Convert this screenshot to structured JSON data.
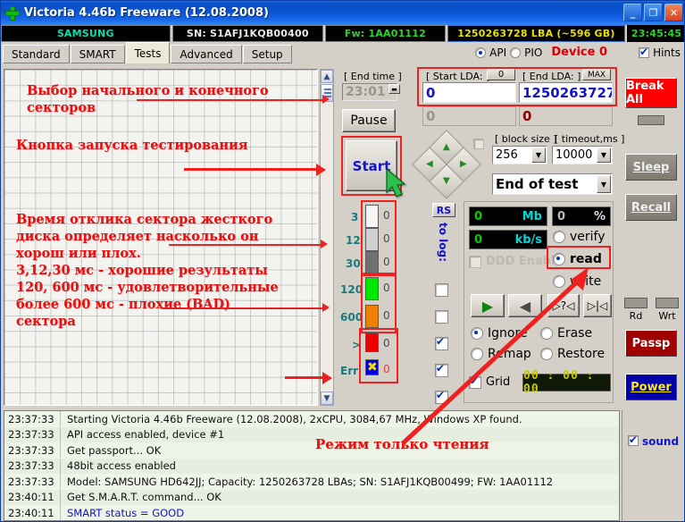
{
  "window": {
    "title": "Victoria 4.46b Freeware (12.08.2008)",
    "icon": "green-cross-icon",
    "minimize": "_",
    "maximize": "❐",
    "close": "✕"
  },
  "device_info": {
    "model": "SAMSUNG",
    "serial": "SN: S1AFJ1KQB00400",
    "firmware": "Fw: 1AA01112",
    "capacity": "1250263728 LBA (~596 GB)",
    "clock": "23:45:45"
  },
  "tabs": [
    {
      "label": "Standard",
      "active": false
    },
    {
      "label": "SMART",
      "active": false
    },
    {
      "label": "Tests",
      "active": true
    },
    {
      "label": "Advanced",
      "active": false
    },
    {
      "label": "Setup",
      "active": false
    }
  ],
  "access_mode": {
    "api_label": "API",
    "api_selected": true,
    "pio_label": "PIO",
    "pio_selected": false,
    "device_label": "Device 0"
  },
  "hints": {
    "label": "Hints",
    "checked": true
  },
  "annotations": {
    "sector_range": "Выбор начального и конечного\nсекторов",
    "start_button": "Кнопка запуска тестирования",
    "timings": "Время отклика сектора жесткого\nдиска определяет насколько он\nхорош или плох.\n3,12,30 мс - хорошие результаты\n120, 600 мс - удовлетворительные\nболее 600 мс - плохие (BAD)\nсектора",
    "read_only": "Режим только чтения"
  },
  "panel": {
    "end_time_label": "[ End time ]",
    "end_time_value": "23:01",
    "start_lba_label": "[ Start LDA: ]",
    "start_lba_zero": "0",
    "start_lba_value": "0",
    "end_lba_label": "[ End LDA: ]",
    "end_lba_max": "MAX",
    "end_lba_value": "1250263727",
    "cur_start_value": "0",
    "cur_end_value": "0",
    "pause_label": "Pause",
    "start_label": "Start",
    "block_size_label": "[ block size ]",
    "block_size_value": "256",
    "timeout_label": "[ timeout,ms ]",
    "timeout_value": "10000",
    "end_of_test_value": "End of test",
    "rs_label": "RS",
    "to_log_label": "to log:",
    "to_log_checks": [
      false,
      false,
      true,
      true,
      true
    ],
    "mb_value": "0",
    "mb_unit": "Mb",
    "pct_value": "0",
    "pct_unit": "%",
    "kbs_value": "0",
    "kbs_unit": "kb/s",
    "ddd_enable_label": "DDD Enable",
    "ddd_enable_checked": false,
    "ops": [
      {
        "label": "verify",
        "selected": false
      },
      {
        "label": "read",
        "selected": true
      },
      {
        "label": "write",
        "selected": false
      }
    ],
    "transport": [
      "▶",
      "◀",
      "?",
      "▶|◀"
    ],
    "bad_actions": [
      {
        "label": "Ignore",
        "selected": true
      },
      {
        "label": "Erase",
        "selected": false
      },
      {
        "label": "Remap",
        "selected": false
      },
      {
        "label": "Restore",
        "selected": false
      }
    ],
    "grid_label": "Grid",
    "grid_checked": true,
    "timer_value": "00 : 00 : 00"
  },
  "timings": [
    {
      "label": "3",
      "color": "#f5f5f5",
      "count": "0"
    },
    {
      "label": "12",
      "color": "#d0d0d0",
      "count": "0"
    },
    {
      "label": "30",
      "color": "#707070",
      "count": "0"
    },
    {
      "label": "120",
      "color": "#00e800",
      "count": "0"
    },
    {
      "label": "600",
      "color": "#f08000",
      "count": "0"
    },
    {
      "label": ">",
      "color": "#ee0000",
      "count": "0"
    },
    {
      "label": "Err",
      "color": "#0000dd",
      "count": "0"
    }
  ],
  "right_buttons": {
    "break_all": "Break All",
    "sleep": "Sleep",
    "recall": "Recall",
    "rd_label": "Rd",
    "wrt_label": "Wrt",
    "passp": "Passp",
    "power": "Power"
  },
  "log": [
    {
      "time": "23:37:33",
      "msg": "Starting Victoria 4.46b Freeware (12.08.2008), 2xCPU, 3084,67 MHz, Windows XP found."
    },
    {
      "time": "23:37:33",
      "msg": "API access enabled, device #1"
    },
    {
      "time": "23:37:33",
      "msg": "Get passport... OK"
    },
    {
      "time": "23:37:33",
      "msg": "48bit access enabled"
    },
    {
      "time": "23:37:33",
      "msg": "Model: SAMSUNG HD642JJ; Capacity: 1250263728 LBAs; SN: S1AFJ1KQB00499; FW: 1AA01112"
    },
    {
      "time": "23:40:11",
      "msg": "Get S.M.A.R.T. command... OK"
    },
    {
      "time": "23:40:11",
      "msg": "SMART status = GOOD",
      "smart": true
    }
  ],
  "sound": {
    "label": "sound",
    "checked": true
  },
  "colors": {
    "title_blue": "#0a4fc8",
    "annotation_red": "#e81010",
    "highlight_red": "#ef2020",
    "accent_blue": "#1414c8",
    "break_red": "#fe0000",
    "power_blue": "#0000a8",
    "power_yellow": "#ffe800"
  }
}
